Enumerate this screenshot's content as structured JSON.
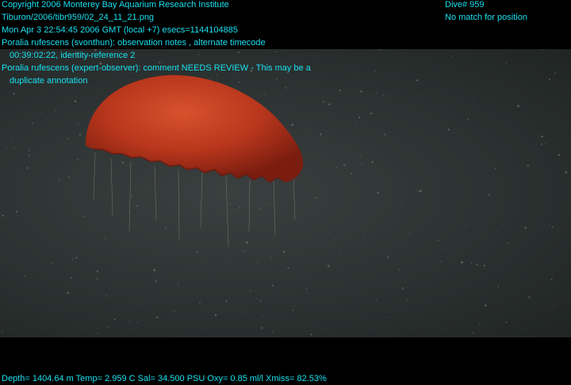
{
  "overlay": {
    "copyright": "Copyright 2006 Monterey Bay Aquarium Research Institute",
    "filename": "Tiburon/2006/tibr959/02_24_11_21.png",
    "timestamp": "Mon Apr  3 22:54:45 2006 GMT (local +7)  esecs=1144104885",
    "annotation1_line1": "Poralia rufescens (svonthun): observation notes , alternate timecode",
    "annotation1_line2": "00:39:02:22, identity-reference 2",
    "annotation2_line1": "Poralia rufescens (expert-observer): comment NEEDS REVIEW - This may be a",
    "annotation2_line2": "duplicate annotation",
    "dive": "Dive# 959",
    "position": "No match for position",
    "sensors": "Depth= 1404.64 m  Temp= 2.959 C  Sal= 34.500 PSU  Oxy= 0.85 ml/l  Xmiss= 82.53%"
  },
  "colors": {
    "overlay_text": "#19e0f0",
    "background": "#000000",
    "water": "#2c3231",
    "jellyfish": "#c23a1e"
  }
}
